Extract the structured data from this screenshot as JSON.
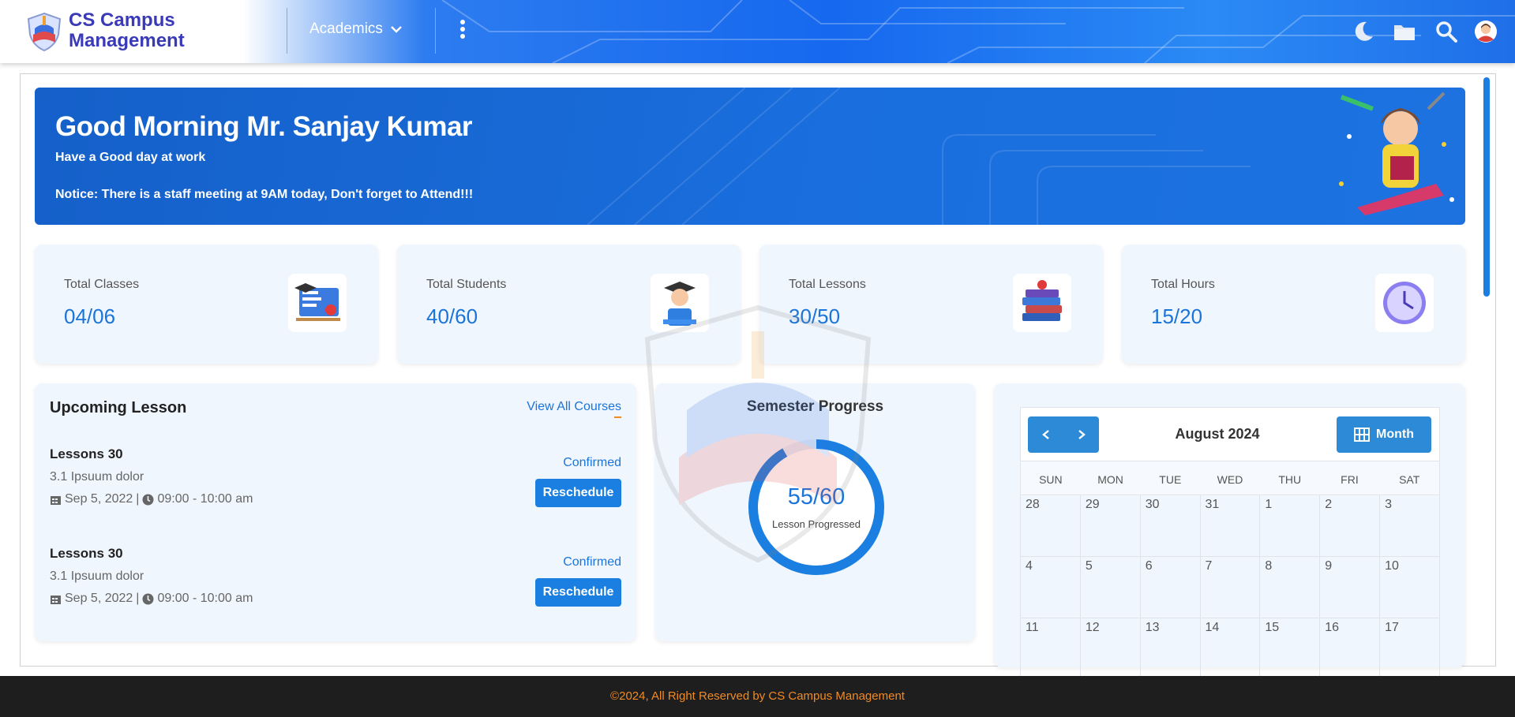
{
  "brand": {
    "line1": "CS Campus",
    "line2": "Management",
    "logo_icon": "campus-book-logo-icon"
  },
  "nav": {
    "academics_label": "Academics"
  },
  "toolbar_icons": [
    "moon-icon",
    "folder-icon",
    "search-icon",
    "user-avatar-icon"
  ],
  "banner": {
    "greeting": "Good Morning Mr. Sanjay Kumar",
    "subtitle": "Have a Good day at work",
    "notice": "Notice: There is a staff meeting at 9AM today, Don't forget to Attend!!!"
  },
  "stats": [
    {
      "label": "Total Classes",
      "value": "04/06",
      "icon": "classroom-board-icon"
    },
    {
      "label": "Total Students",
      "value": "40/60",
      "icon": "graduate-student-icon"
    },
    {
      "label": "Total Lessons",
      "value": "30/50",
      "icon": "book-stack-icon"
    },
    {
      "label": "Total Hours",
      "value": "15/20",
      "icon": "clock-icon"
    }
  ],
  "upcoming": {
    "title": "Upcoming Lesson",
    "view_all": "View All Courses",
    "lessons": [
      {
        "name": "Lessons 30",
        "topic": "3.1 Ipsuum dolor",
        "date": "Sep 5, 2022",
        "separator": "|",
        "time": "09:00 - 10:00 am",
        "status": "Confirmed",
        "action": "Reschedule"
      },
      {
        "name": "Lessons 30",
        "topic": "3.1 Ipsuum dolor",
        "date": "Sep 5, 2022",
        "separator": "|",
        "time": "09:00 - 10:00 am",
        "status": "Confirmed",
        "action": "Reschedule"
      }
    ]
  },
  "semester": {
    "title": "Semester Progress",
    "value": "55/60",
    "caption": "Lesson Progressed",
    "progress_fraction": 0.9167
  },
  "calendar": {
    "month_label": "August 2024",
    "view_button": "Month",
    "weekdays": [
      "SUN",
      "MON",
      "TUE",
      "WED",
      "THU",
      "FRI",
      "SAT"
    ],
    "weeks": [
      [
        "28",
        "29",
        "30",
        "31",
        "1",
        "2",
        "3"
      ],
      [
        "4",
        "5",
        "6",
        "7",
        "8",
        "9",
        "10"
      ],
      [
        "11",
        "12",
        "13",
        "14",
        "15",
        "16",
        "17"
      ]
    ]
  },
  "footer": {
    "text": "©2024, All Right Reserved by CS Campus Management"
  },
  "colors": {
    "primary": "#1a7fe0",
    "banner": "#1a6fdf",
    "footer_text": "#f08a24",
    "card_bg": "#f0f6fd"
  }
}
